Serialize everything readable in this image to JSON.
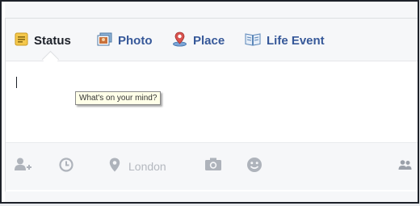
{
  "composer": {
    "tabs": [
      {
        "label": "Status"
      },
      {
        "label": "Photo"
      },
      {
        "label": "Place"
      },
      {
        "label": "Life Event"
      }
    ],
    "text_value": "",
    "tooltip": "What's on your mind?",
    "location_value": "London"
  },
  "icons": {
    "status": "status-note-icon",
    "photo": "photo-icon",
    "place": "place-pin-icon",
    "life_event": "life-event-book-icon",
    "tag": "tag-people-icon",
    "time": "clock-icon",
    "location": "location-pin-icon",
    "camera": "camera-icon",
    "feeling": "smiley-icon",
    "audience": "audience-friends-icon"
  },
  "colors": {
    "link": "#365899",
    "tab_active": "#1d2129",
    "icon_gray": "#aeb3bb",
    "bar_bg": "#f6f7f9"
  }
}
